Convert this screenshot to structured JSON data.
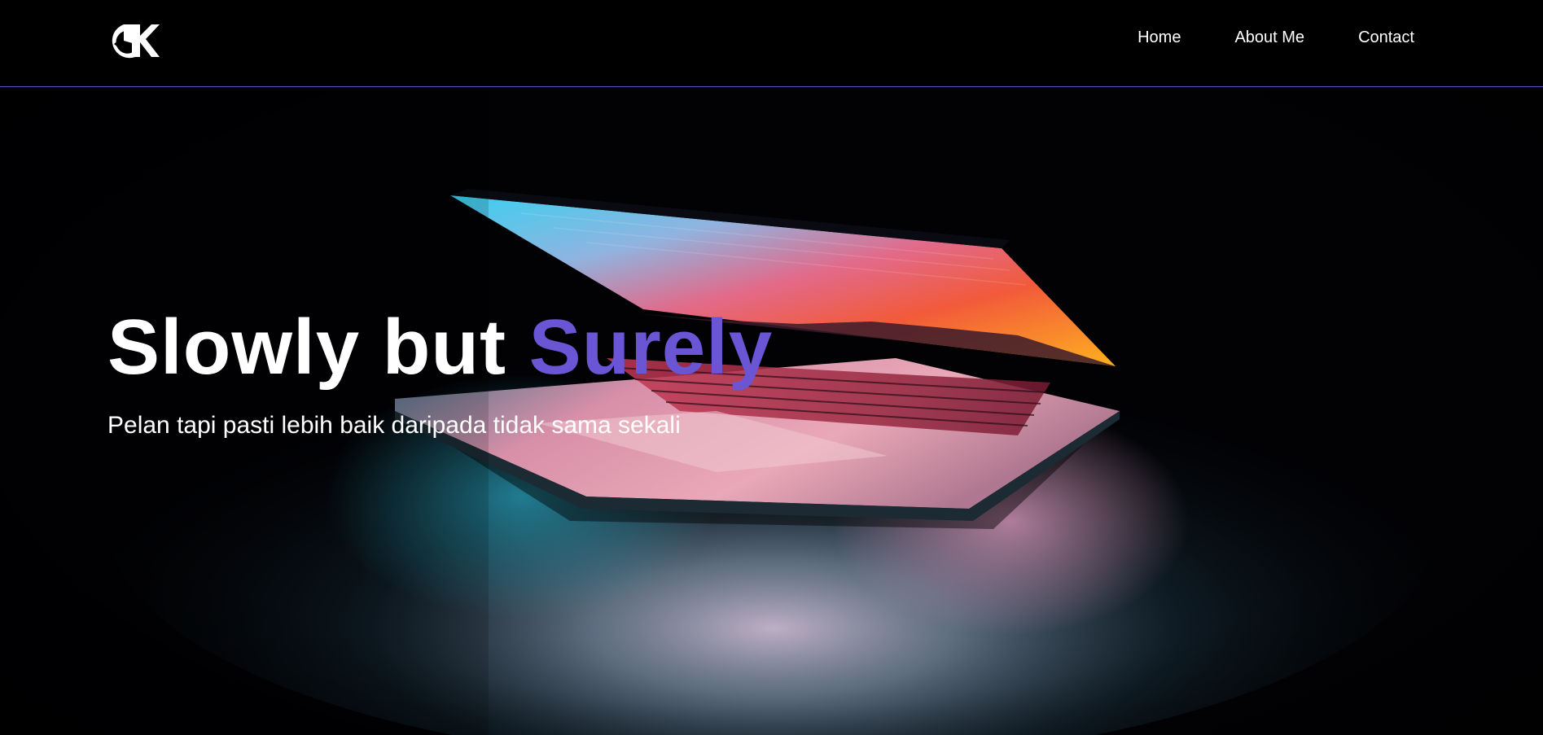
{
  "navbar": {
    "logo_alt": "logo",
    "links": [
      {
        "label": "Home"
      },
      {
        "label": "About Me"
      },
      {
        "label": "Contact"
      }
    ]
  },
  "hero": {
    "title_main": "Slowly but ",
    "title_accent": "Surely",
    "subtitle": "Pelan tapi pasti lebih baik daripada tidak sama sekali"
  },
  "colors": {
    "accent": "#6a56d4",
    "nav_border": "#5b4fc4",
    "background": "#000000",
    "text": "#ffffff"
  },
  "icons": {
    "logo": "dk-monogram-logo"
  }
}
